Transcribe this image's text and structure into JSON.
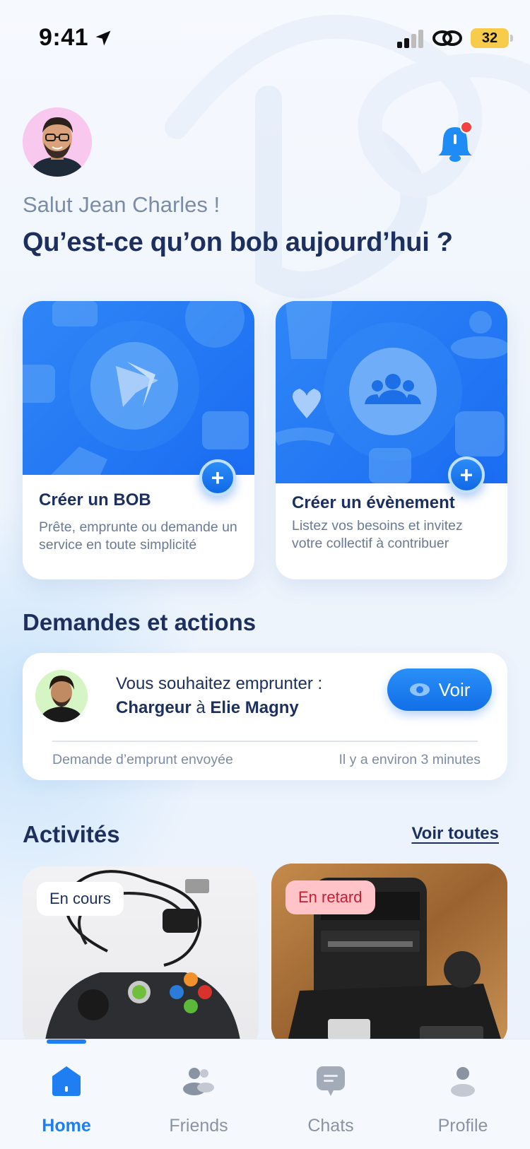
{
  "status_bar": {
    "time": "9:41",
    "battery": "32"
  },
  "header": {
    "greeting": "Salut Jean Charles !",
    "headline": "Qu’est-ce qu’on bob aujourd’hui ?"
  },
  "action_cards": [
    {
      "title": "Créer un BOB",
      "description": "Prête, emprunte ou demande un service en toute simplicité",
      "button": "+"
    },
    {
      "title": "Créer un évènement",
      "description": "Listez vos besoins et invitez votre collectif à contribuer",
      "button": "+"
    }
  ],
  "requests": {
    "section_title": "Demandes et actions",
    "item": {
      "line1": "Vous souhaitez emprunter :",
      "item_name": "Chargeur",
      "connector": "à",
      "person": "Elie Magny",
      "button_label": "Voir",
      "status": "Demande d’emprunt envoyée",
      "time": "Il y a environ 3 minutes"
    }
  },
  "activities": {
    "title": "Activités",
    "see_all": "Voir toutes",
    "items": [
      {
        "badge": "En cours"
      },
      {
        "badge": "En retard"
      }
    ]
  },
  "tabbar": {
    "tabs": [
      {
        "label": "Home",
        "icon": "home-icon",
        "active": true
      },
      {
        "label": "Friends",
        "icon": "friends-icon",
        "active": false
      },
      {
        "label": "Chats",
        "icon": "chat-icon",
        "active": false
      },
      {
        "label": "Profile",
        "icon": "profile-icon",
        "active": false
      }
    ]
  },
  "colors": {
    "primary": "#1f7ef2",
    "text": "#1d2f5e",
    "muted": "#7c8ba6",
    "late_badge": "#ffc3c8"
  }
}
